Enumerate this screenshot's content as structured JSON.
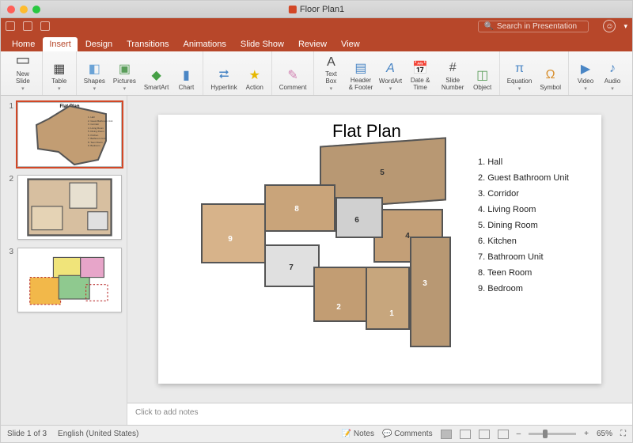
{
  "titlebar": {
    "doc": "Floor Plan1"
  },
  "qat": {
    "search_placeholder": "Search in Presentation"
  },
  "tabs": [
    "Home",
    "Insert",
    "Design",
    "Transitions",
    "Animations",
    "Slide Show",
    "Review",
    "View"
  ],
  "active_tab": "Insert",
  "ribbon": {
    "new_slide": "New\nSlide",
    "table": "Table",
    "shapes": "Shapes",
    "pictures": "Pictures",
    "smartart": "SmartArt",
    "chart": "Chart",
    "hyperlink": "Hyperlink",
    "action": "Action",
    "comment": "Comment",
    "textbox": "Text\nBox",
    "headerfooter": "Header &\nFooter",
    "wordart": "WordArt",
    "datetime": "Date &\nTime",
    "slidenum": "Slide\nNumber",
    "object": "Object",
    "equation": "Equation",
    "symbol": "Symbol",
    "video": "Video",
    "audio": "Audio"
  },
  "thumbs": {
    "nums": [
      "1",
      "2",
      "3"
    ],
    "t1_title": "Flat Plan",
    "t1_leg": [
      "1. Hall",
      "2. Guest Bathroom Unit",
      "3. Corridor",
      "4. Living Room",
      "5. Dining Room",
      "6. Kitchen",
      "7. Bathroom Unit",
      "8. Teen Room",
      "9. Bedroom"
    ]
  },
  "slide": {
    "title": "Flat Plan",
    "legend": [
      "1. Hall",
      "2. Guest Bathroom Unit",
      "3. Corridor",
      "4. Living Room",
      "5. Dining Room",
      "6. Kitchen",
      "7. Bathroom Unit",
      "8. Teen Room",
      "9. Bedroom"
    ],
    "labels": {
      "l1": "1",
      "l2": "2",
      "l3": "3",
      "l4": "4",
      "l5": "5",
      "l6": "6",
      "l7": "7",
      "l8": "8",
      "l9": "9"
    }
  },
  "notes_placeholder": "Click to add notes",
  "status": {
    "slide_of": "Slide 1 of 3",
    "lang": "English (United States)",
    "notes": "Notes",
    "comments": "Comments",
    "zoom": "65%",
    "plus": "+",
    "minus": "–"
  }
}
